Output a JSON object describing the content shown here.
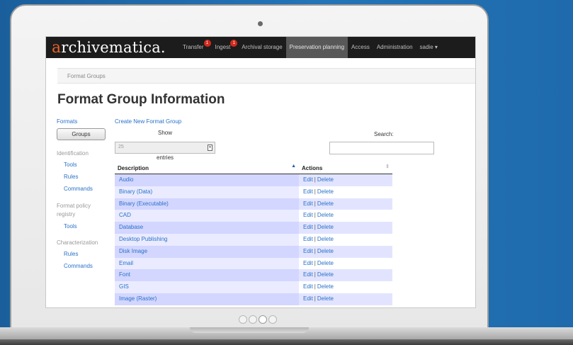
{
  "navbar": {
    "logo_initial": "a",
    "logo_rest": "rchivematica.",
    "items": [
      {
        "label": "Transfer",
        "badge": "1"
      },
      {
        "label": "Ingest",
        "badge": "1"
      },
      {
        "label": "Archival storage",
        "badge": ""
      },
      {
        "label": "Preservation planning",
        "badge": ""
      },
      {
        "label": "Access",
        "badge": ""
      },
      {
        "label": "Administration",
        "badge": ""
      },
      {
        "label": "sadie ▾",
        "badge": ""
      }
    ],
    "active_item": "Preservation planning"
  },
  "breadcrumb": "Format Groups",
  "page_title": "Format Group Information",
  "sidebar": {
    "formats_link": "Formats",
    "groups_button": "Groups",
    "identification": "Identification",
    "identification_tools": "Tools",
    "identification_rules": "Rules",
    "identification_commands": "Commands",
    "policy_registry": "Format policy registry",
    "policy_tools": "Tools",
    "characterization": "Characterization",
    "char_rules": "Rules",
    "char_commands": "Commands"
  },
  "main": {
    "create_link": "Create New Format Group",
    "show_label": "Show",
    "show_value": "25",
    "entries_label": "entries",
    "search_label": "Search:",
    "search_value": ""
  },
  "table": {
    "headers": [
      "Description",
      "Actions"
    ],
    "edit_label": "Edit",
    "delete_label": "Delete",
    "rows": [
      "Audio",
      "Binary (Data)",
      "Binary (Executable)",
      "CAD",
      "Database",
      "Desktop Publishing",
      "Disk Image",
      "Email",
      "Font",
      "GIS",
      "Image (Raster)"
    ]
  },
  "colors": {
    "background": "#1f6fb2",
    "navbar": "#1c1c1c",
    "logo_accent": "#e8622a",
    "link": "#2a72c8",
    "badge": "#d42a1c",
    "row_odd": "#e2e4ff"
  },
  "carousel": {
    "total": 4,
    "active": 3
  }
}
